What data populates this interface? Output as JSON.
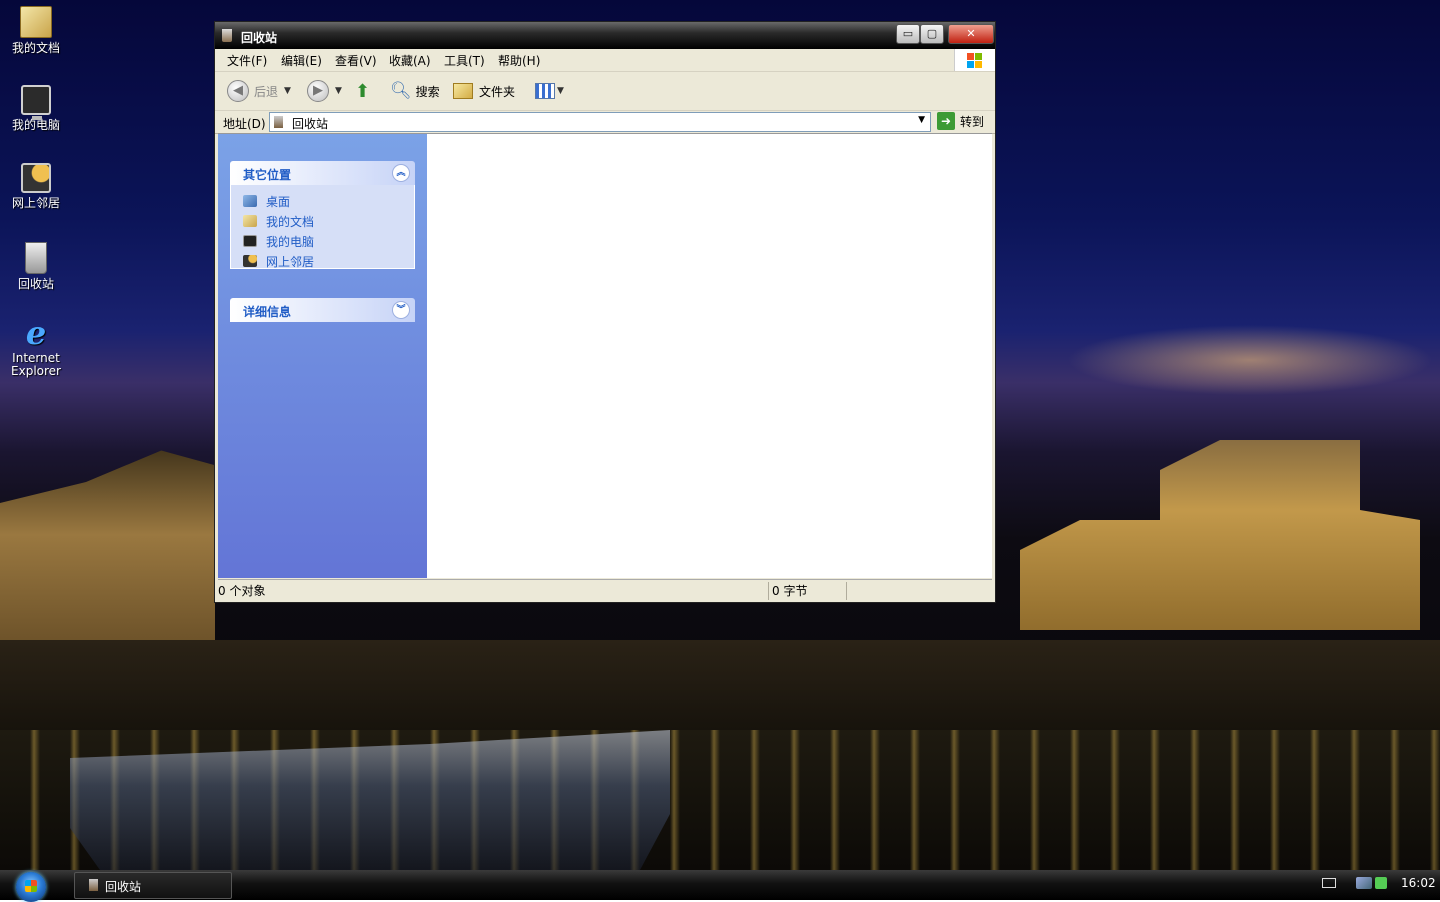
{
  "desktop": {
    "icons": [
      {
        "label_line1": "我的文档",
        "label_line2": "",
        "icon": "folder-icon"
      },
      {
        "label_line1": "我的电脑",
        "label_line2": "",
        "icon": "computer-icon"
      },
      {
        "label_line1": "网上邻居",
        "label_line2": "",
        "icon": "network-icon"
      },
      {
        "label_line1": "回收站",
        "label_line2": "",
        "icon": "recycle-bin-icon"
      },
      {
        "label_line1": "Internet",
        "label_line2": "Explorer",
        "icon": "internet-explorer-icon"
      }
    ]
  },
  "window": {
    "title": "回收站",
    "caption_buttons": {
      "minimize": "▭",
      "maximize": "▢",
      "close": "✕"
    },
    "menu": [
      "文件(F)",
      "编辑(E)",
      "查看(V)",
      "收藏(A)",
      "工具(T)",
      "帮助(H)"
    ],
    "toolbar": {
      "back": "后退",
      "search": "搜索",
      "folders": "文件夹"
    },
    "address": {
      "label": "地址(D)",
      "value": "回收站",
      "go": "转到"
    },
    "task_pane": {
      "other_places": {
        "title": "其它位置",
        "links": [
          "桌面",
          "我的文档",
          "我的电脑",
          "网上邻居"
        ]
      },
      "details": {
        "title": "详细信息"
      }
    },
    "status": {
      "objects": "0 个对象",
      "bytes": "0 字节"
    }
  },
  "taskbar": {
    "task_title": "回收站",
    "clock": "16:02"
  },
  "colors": {
    "task_pane_link": "#215dc6",
    "task_pane_bg_top": "#7ba2e7",
    "task_pane_bg_bottom": "#6375d6",
    "title_bar": "#000000",
    "close_button": "#c02010"
  }
}
